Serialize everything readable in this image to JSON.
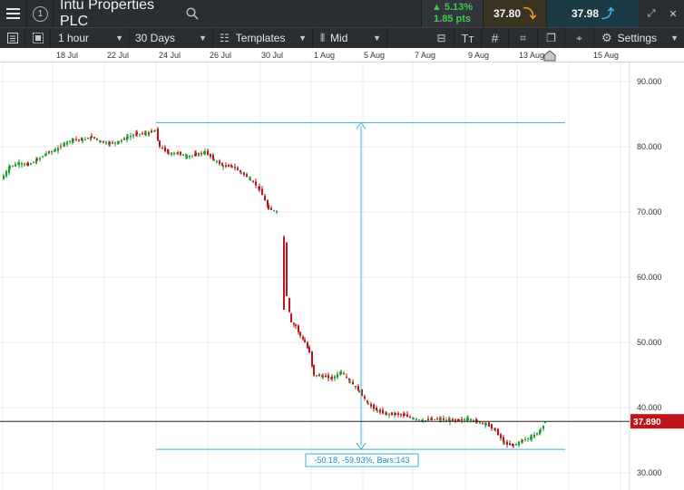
{
  "header": {
    "menu_icon": "hamburger-icon",
    "number_badge": "1",
    "instrument": "Intu Properties PLC",
    "search_icon": "search-icon",
    "change_pct": "5.13%",
    "change_pts": "1.85 pts",
    "sell_price": "37.80",
    "buy_price": "37.98",
    "expand_icon": "expand-icon",
    "close_icon": "close-icon"
  },
  "toolbar": {
    "interval": "1 hour",
    "range": "30 Days",
    "templates": "Templates",
    "price_type": "Mid",
    "settings": "Settings"
  },
  "colors": {
    "up_candle": "#1f9e2f",
    "down_candle": "#c0141b",
    "measure": "#3bb3d6",
    "current_price_tag": "#c0141b"
  },
  "chart_data": {
    "type": "candlestick",
    "title": "Intu Properties PLC",
    "x_tick_labels": [
      "18 Jul",
      "22 Jul",
      "24 Jul",
      "26 Jul",
      "30 Jul",
      "1 Aug",
      "5 Aug",
      "7 Aug",
      "9 Aug",
      "13 Aug",
      "15 Aug"
    ],
    "y_tick_labels": [
      "90.000",
      "80.000",
      "70.000",
      "60.000",
      "50.000",
      "40.000",
      "30.000"
    ],
    "ylim": [
      27.5,
      92.5
    ],
    "current_price": 37.89,
    "current_price_label": "37.890",
    "measurement": {
      "upper_price": 83.7,
      "lower_price": 33.6,
      "label": "-50.18, -59.93%, Bars:143"
    },
    "price_path": [
      [
        0,
        75.0
      ],
      [
        10,
        77.0
      ],
      [
        20,
        77.5
      ],
      [
        30,
        77.2
      ],
      [
        40,
        78.0
      ],
      [
        50,
        79.0
      ],
      [
        60,
        79.5
      ],
      [
        70,
        80.5
      ],
      [
        80,
        81.2
      ],
      [
        90,
        81.0
      ],
      [
        100,
        81.5
      ],
      [
        110,
        80.8
      ],
      [
        120,
        80.5
      ],
      [
        130,
        80.8
      ],
      [
        140,
        81.5
      ],
      [
        150,
        82.0
      ],
      [
        160,
        82.0
      ],
      [
        170,
        82.5
      ],
      [
        175,
        80.0
      ],
      [
        185,
        79.0
      ],
      [
        195,
        79.0
      ],
      [
        205,
        78.5
      ],
      [
        215,
        78.8
      ],
      [
        225,
        79.2
      ],
      [
        235,
        78.0
      ],
      [
        245,
        77.0
      ],
      [
        255,
        77.0
      ],
      [
        265,
        76.0
      ],
      [
        275,
        75.0
      ],
      [
        285,
        73.5
      ],
      [
        295,
        70.5
      ],
      [
        305,
        70.0
      ],
      [
        312,
        65.5
      ],
      [
        315,
        57.0
      ],
      [
        320,
        53.0
      ],
      [
        325,
        52.5
      ],
      [
        330,
        51.0
      ],
      [
        335,
        50.0
      ],
      [
        340,
        48.5
      ],
      [
        345,
        45.0
      ],
      [
        355,
        44.8
      ],
      [
        365,
        44.5
      ],
      [
        375,
        45.5
      ],
      [
        385,
        44.0
      ],
      [
        395,
        42.5
      ],
      [
        405,
        40.5
      ],
      [
        415,
        39.5
      ],
      [
        425,
        39.0
      ],
      [
        435,
        39.0
      ],
      [
        445,
        38.8
      ],
      [
        455,
        38.3
      ],
      [
        465,
        38.0
      ],
      [
        475,
        38.2
      ],
      [
        485,
        38.2
      ],
      [
        495,
        38.0
      ],
      [
        505,
        38.0
      ],
      [
        515,
        38.3
      ],
      [
        525,
        37.8
      ],
      [
        535,
        37.5
      ],
      [
        545,
        36.5
      ],
      [
        555,
        34.5
      ],
      [
        565,
        34.2
      ],
      [
        575,
        35.0
      ],
      [
        585,
        35.5
      ],
      [
        595,
        36.5
      ],
      [
        600,
        37.9
      ]
    ]
  }
}
